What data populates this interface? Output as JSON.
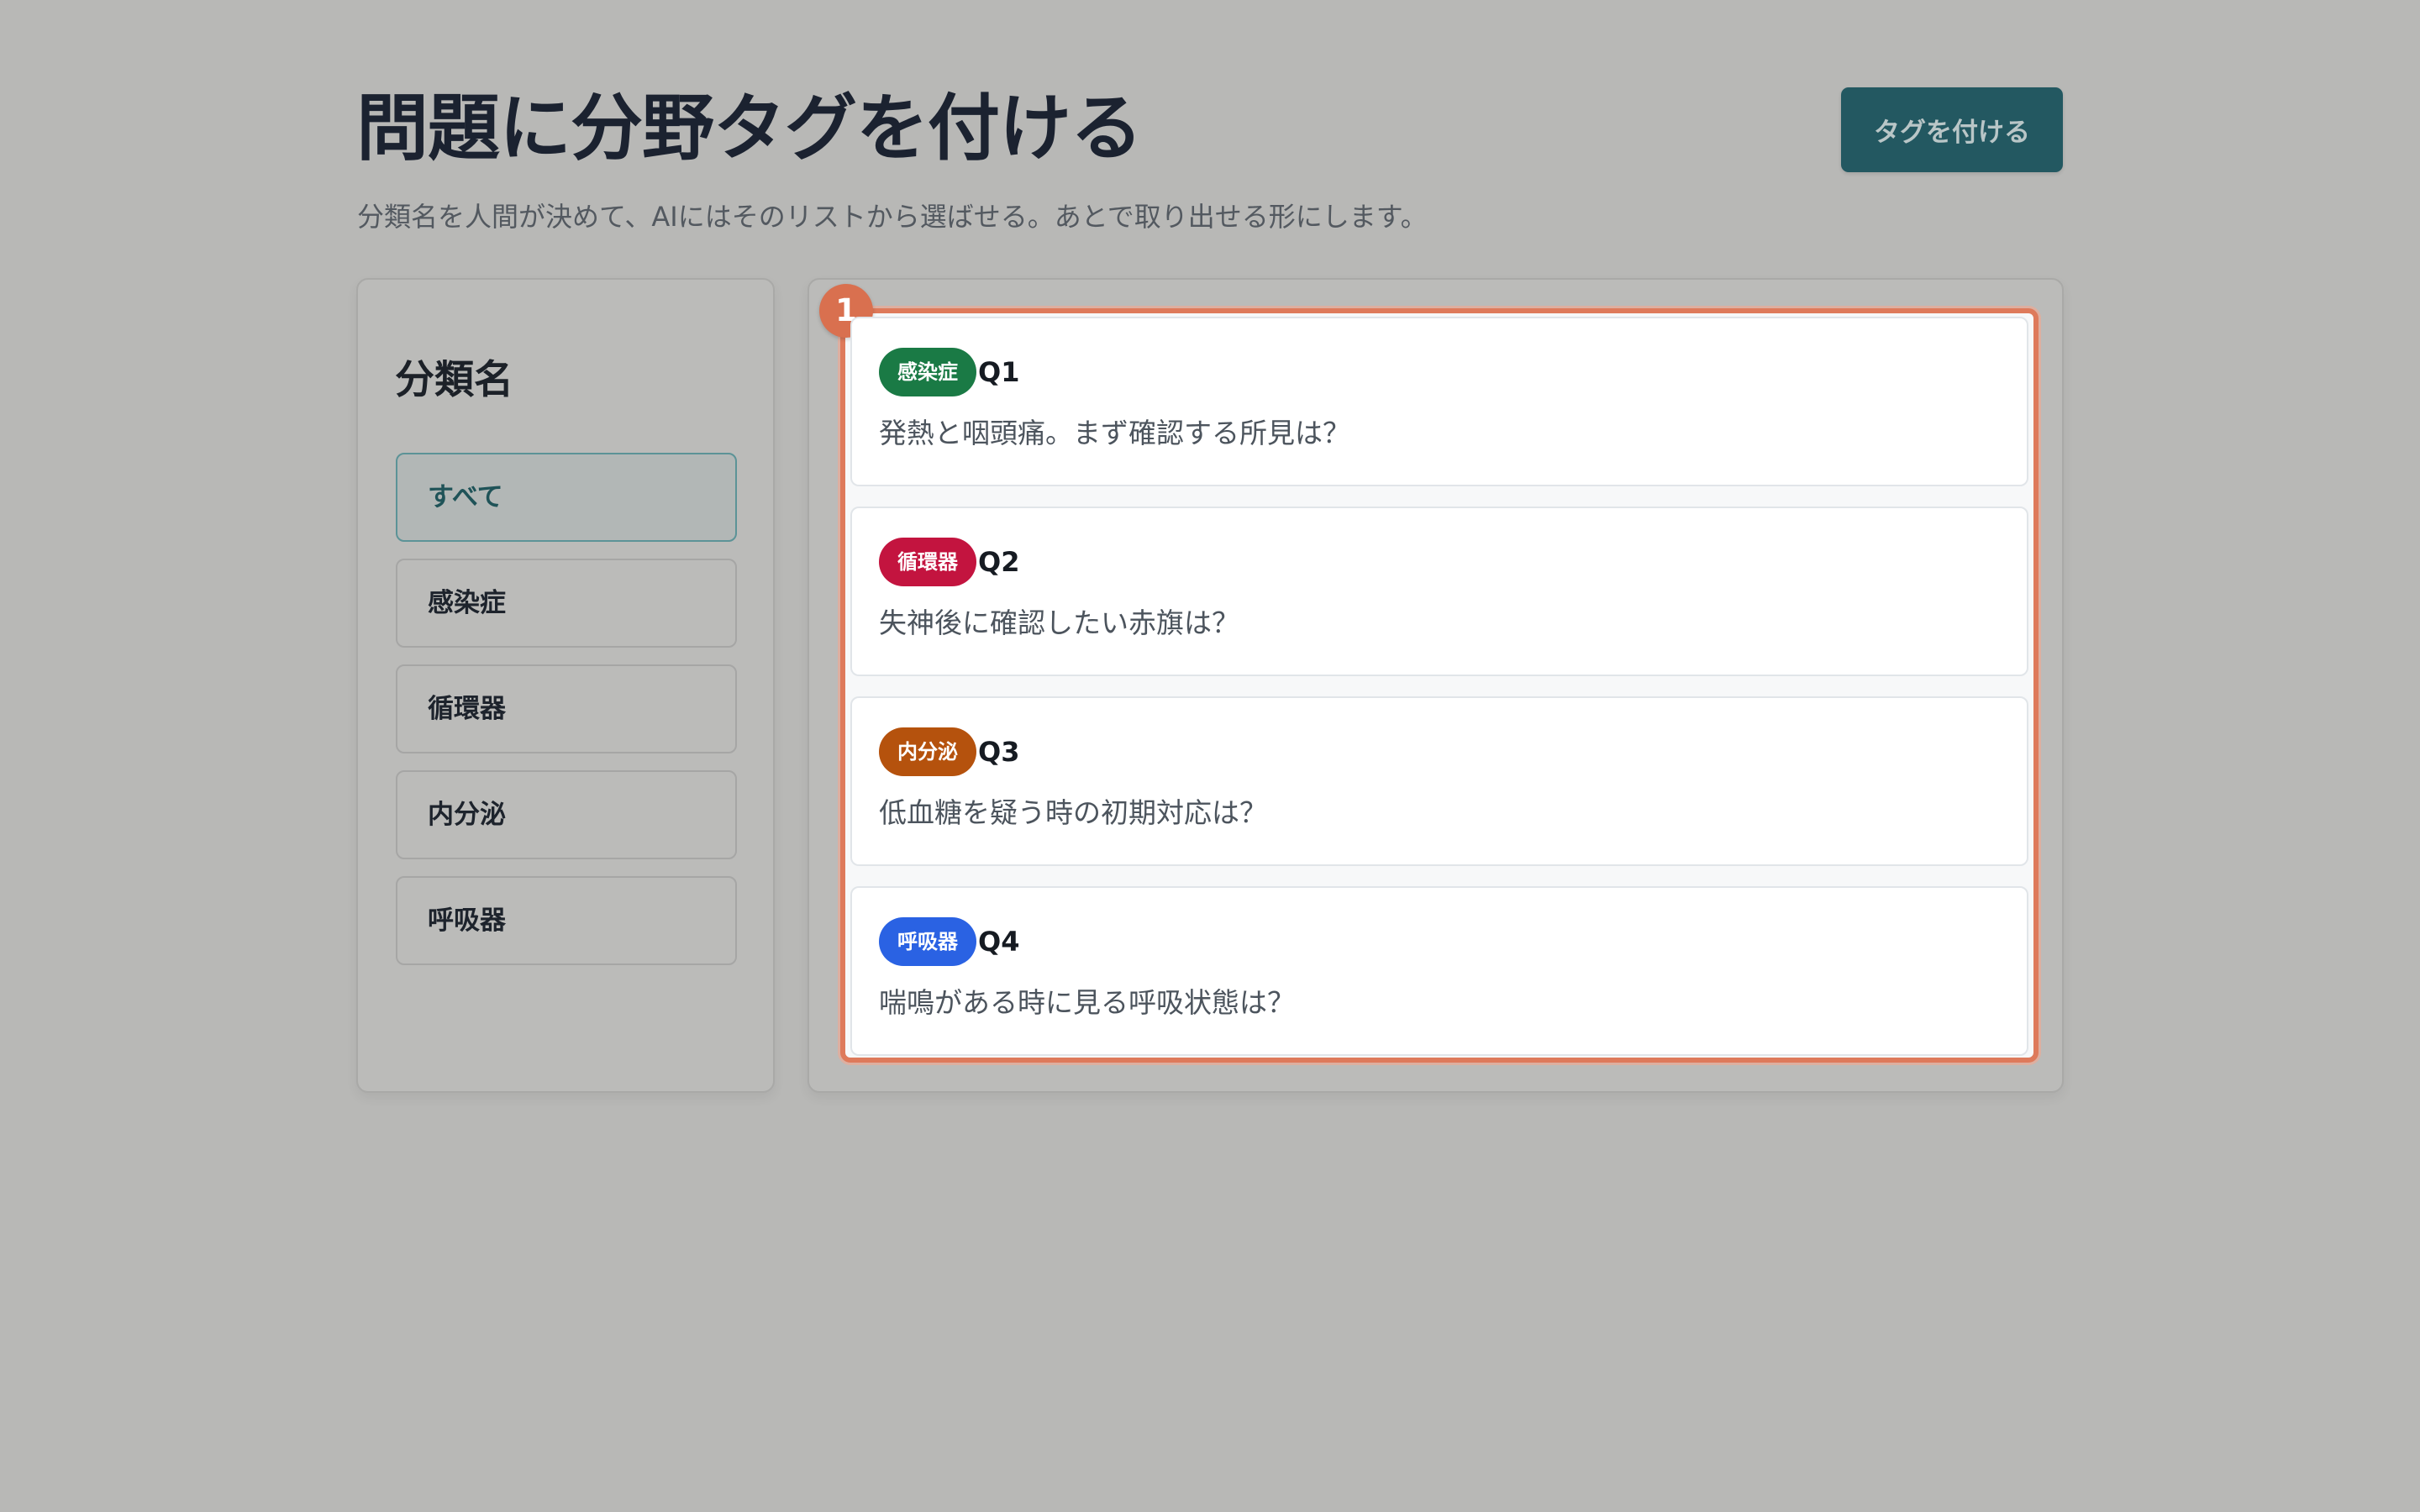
{
  "header": {
    "title": "問題に分野タグを付ける",
    "subtitle": "分類名を人間が決めて、AIにはそのリストから選ばせる。あとで取り出せる形にします。",
    "action_label": "タグを付ける"
  },
  "sidebar": {
    "heading": "分類名",
    "items": [
      {
        "label": "すべて",
        "active": true
      },
      {
        "label": "感染症",
        "active": false
      },
      {
        "label": "循環器",
        "active": false
      },
      {
        "label": "内分泌",
        "active": false
      },
      {
        "label": "呼吸器",
        "active": false
      }
    ]
  },
  "highlight": {
    "step": "1",
    "color": "#de7a5b"
  },
  "questions": [
    {
      "tag": "感染症",
      "tag_color": "#1a7a45",
      "id": "Q1",
      "text": "発熱と咽頭痛。まず確認する所見は？"
    },
    {
      "tag": "循環器",
      "tag_color": "#c3143f",
      "id": "Q2",
      "text": "失神後に確認したい赤旗は？"
    },
    {
      "tag": "内分泌",
      "tag_color": "#b5520d",
      "id": "Q3",
      "text": "低血糖を疑う時の初期対応は？"
    },
    {
      "tag": "呼吸器",
      "tag_color": "#2a62e3",
      "id": "Q4",
      "text": "喘鳴がある時に見る呼吸状態は？"
    }
  ]
}
